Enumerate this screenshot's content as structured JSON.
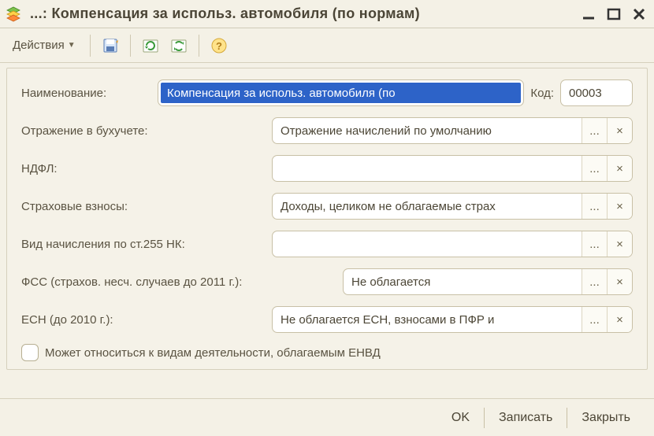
{
  "window": {
    "title": "...: Компенсация за использ. автомобиля (по нормам)"
  },
  "toolbar": {
    "actions_label": "Действия"
  },
  "form": {
    "name_label": "Наименование:",
    "name_value": "Компенсация за использ. автомобиля (по",
    "code_label": "Код:",
    "code_value": "00003",
    "reflection_label": "Отражение в бухучете:",
    "reflection_value": "Отражение начислений по умолчанию",
    "ndfl_label": "НДФЛ:",
    "ndfl_value": "",
    "insurance_label": "Страховые взносы:",
    "insurance_value": "Доходы, целиком не облагаемые страх",
    "st255_label": "Вид начисления по ст.255 НК:",
    "st255_value": "",
    "fss_label": "ФСС (страхов. несч. случаев до 2011 г.):",
    "fss_value": "Не облагается",
    "esn_label": "ЕСН (до 2010 г.):",
    "esn_value": "Не облагается ЕСН, взносами в ПФР и",
    "checkbox_label": "Может относиться к видам деятельности, облагаемым ЕНВД"
  },
  "buttons": {
    "ellipsis": "...",
    "clear": "×"
  },
  "footer": {
    "ok": "OK",
    "save": "Записать",
    "close": "Закрыть"
  }
}
